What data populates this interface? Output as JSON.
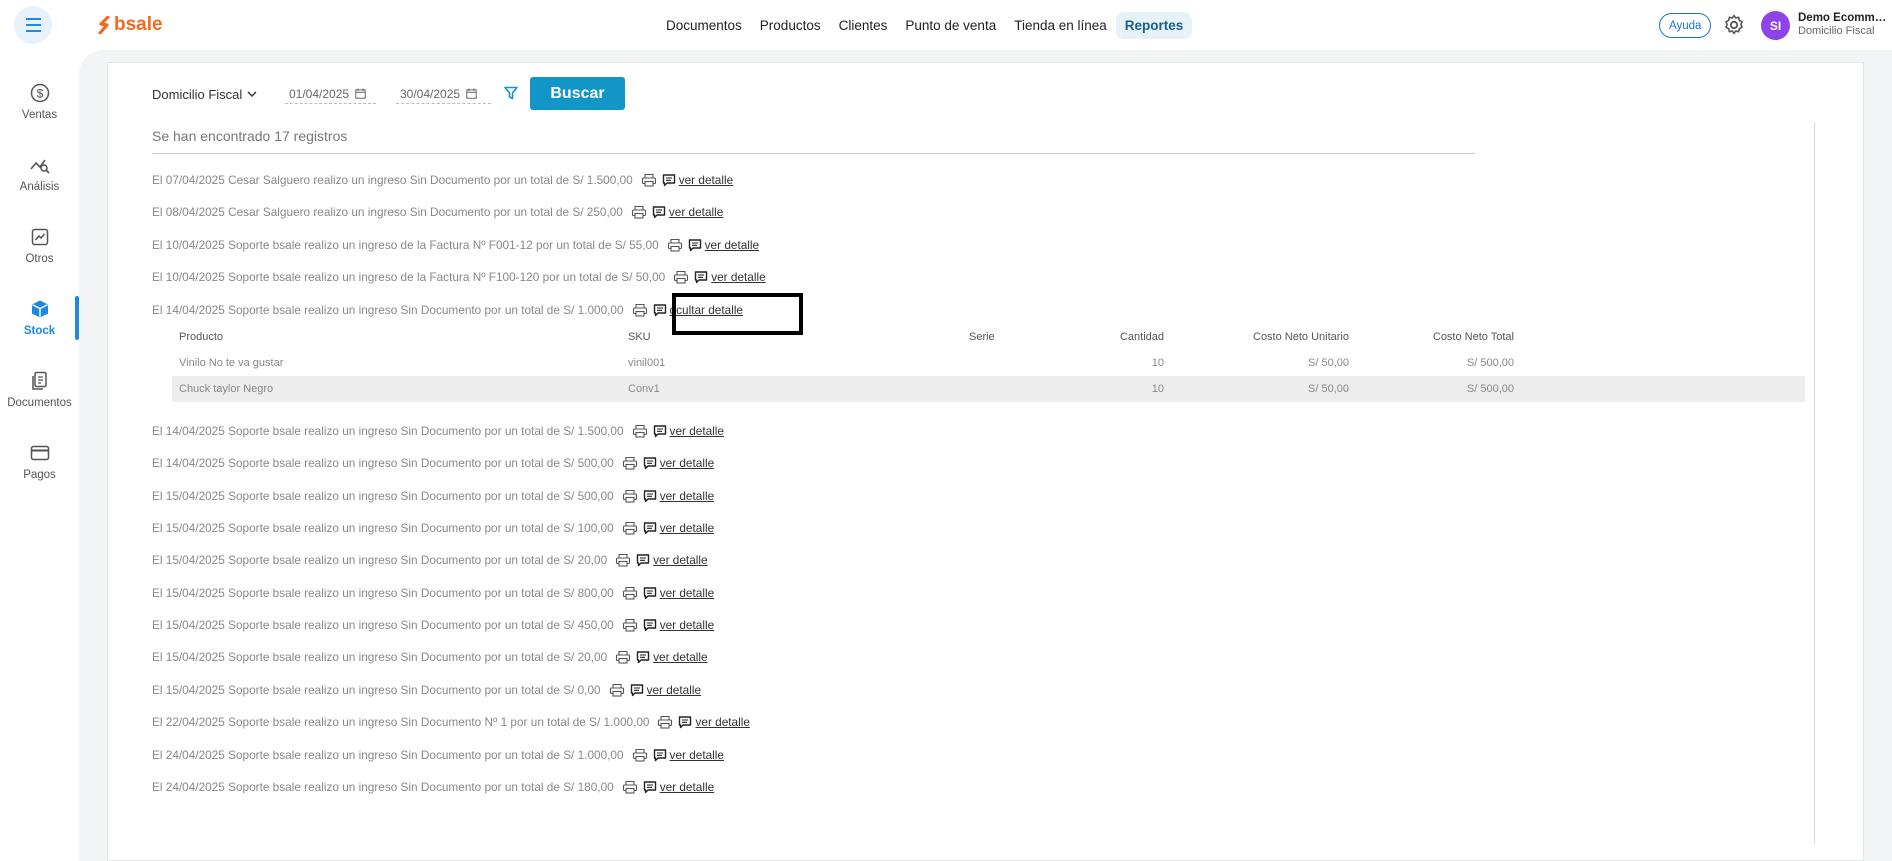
{
  "header": {
    "logo_text": "bsale",
    "nav": [
      {
        "label": "Documentos",
        "active": false
      },
      {
        "label": "Productos",
        "active": false
      },
      {
        "label": "Clientes",
        "active": false
      },
      {
        "label": "Punto de venta",
        "active": false
      },
      {
        "label": "Tienda en línea",
        "active": false
      },
      {
        "label": "Reportes",
        "active": true
      }
    ],
    "help_label": "Ayuda",
    "avatar_initials": "SI",
    "account_name": "Demo Ecommm...",
    "account_sub": "Domicilio Fiscal"
  },
  "sidebar": {
    "items": [
      {
        "label": "Ventas",
        "icon": "dollar-circle-icon",
        "active": false
      },
      {
        "label": "Análisis",
        "icon": "analysis-icon",
        "active": false
      },
      {
        "label": "Otros",
        "icon": "chart-box-icon",
        "active": false
      },
      {
        "label": "Stock",
        "icon": "box-icon",
        "active": true
      },
      {
        "label": "Documentos",
        "icon": "documents-icon",
        "active": false
      },
      {
        "label": "Pagos",
        "icon": "card-icon",
        "active": false
      }
    ]
  },
  "filters": {
    "branch": "Domicilio Fiscal",
    "date_from": "01/04/2025",
    "date_to": "30/04/2025",
    "search_label": "Buscar"
  },
  "results_count": "Se han encontrado 17 registros",
  "rows": [
    {
      "text": "El 07/04/2025 Cesar Salguero realizo un ingreso Sin Documento por un total de S/ 1.500,00",
      "link": "ver detalle"
    },
    {
      "text": "El 08/04/2025 Cesar Salguero realizo un ingreso Sin Documento por un total de S/ 250,00",
      "link": "ver detalle"
    },
    {
      "text": "El 10/04/2025 Soporte bsale realizo un ingreso de la Factura Nº F001-12 por un total de S/ 55,00",
      "link": "ver detalle"
    },
    {
      "text": "El 10/04/2025 Soporte bsale realizo un ingreso de la Factura Nº F100-120 por un total de S/ 50,00",
      "link": "ver detalle"
    },
    {
      "text": "El 14/04/2025 Soporte bsale realizo un ingreso Sin Documento por un total de S/ 1.000,00",
      "link": "ocultar detalle"
    },
    {
      "text": "El 14/04/2025 Soporte bsale realizo un ingreso Sin Documento por un total de S/ 1.500,00",
      "link": "ver detalle"
    },
    {
      "text": "El 14/04/2025 Soporte bsale realizo un ingreso Sin Documento por un total de S/ 500,00",
      "link": "ver detalle"
    },
    {
      "text": "El 15/04/2025 Soporte bsale realizo un ingreso Sin Documento por un total de S/ 500,00",
      "link": "ver detalle"
    },
    {
      "text": "El 15/04/2025 Soporte bsale realizo un ingreso Sin Documento por un total de S/ 100,00",
      "link": "ver detalle"
    },
    {
      "text": "El 15/04/2025 Soporte bsale realizo un ingreso Sin Documento por un total de S/ 20,00",
      "link": "ver detalle"
    },
    {
      "text": "El 15/04/2025 Soporte bsale realizo un ingreso Sin Documento por un total de S/ 800,00",
      "link": "ver detalle"
    },
    {
      "text": "El 15/04/2025 Soporte bsale realizo un ingreso Sin Documento por un total de S/ 450,00",
      "link": "ver detalle"
    },
    {
      "text": "El 15/04/2025 Soporte bsale realizo un ingreso Sin Documento por un total de S/ 20,00",
      "link": "ver detalle"
    },
    {
      "text": "El 15/04/2025 Soporte bsale realizo un ingreso Sin Documento por un total de S/ 0,00",
      "link": "ver detalle"
    },
    {
      "text": "El 22/04/2025 Soporte bsale realizo un ingreso Sin Documento Nº 1 por un total de S/ 1.000,00",
      "link": "ver detalle"
    },
    {
      "text": "El 24/04/2025 Soporte bsale realizo un ingreso Sin Documento por un total de S/ 1.000,00",
      "link": "ver detalle"
    },
    {
      "text": "El 24/04/2025 Soporte bsale realizo un ingreso Sin Documento por un total de S/ 180,00",
      "link": "ver detalle"
    }
  ],
  "detail": {
    "columns": [
      "Producto",
      "SKU",
      "Serie",
      "Cantidad",
      "Costo Neto Unitario",
      "Costo Neto Total"
    ],
    "rows": [
      [
        "Vinilo No te va gustar",
        "vinil001",
        "",
        "10",
        "S/ 50,00",
        "S/ 500,00"
      ],
      [
        "Chuck taylor Negro",
        "Conv1",
        "",
        "10",
        "S/ 50,00",
        "S/ 500,00"
      ]
    ]
  },
  "colors": {
    "accent": "#1296c8",
    "brand": "#f26a21",
    "active_nav": "#1e88e5",
    "avatar": "#8e44e8"
  }
}
